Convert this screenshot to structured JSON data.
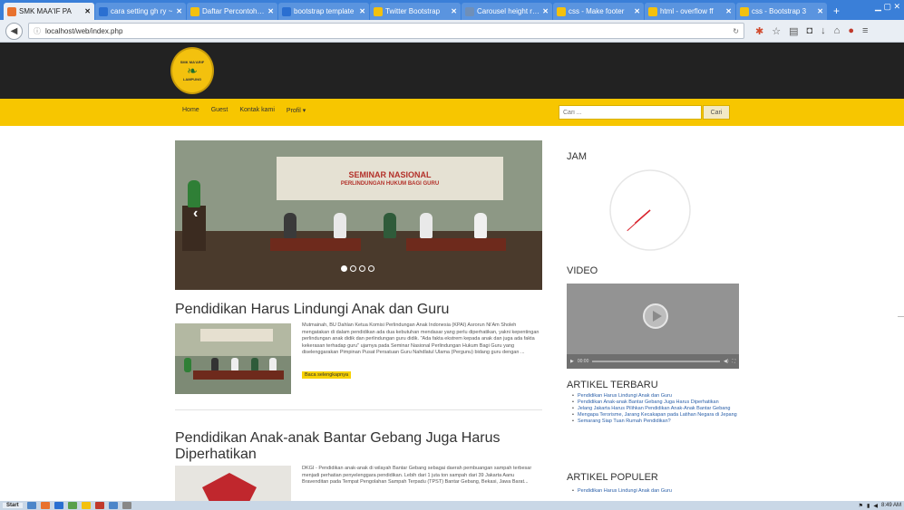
{
  "browser": {
    "tabs": [
      {
        "label": "SMK MAA'IF PA",
        "favicon_color": "#e8722e",
        "active": true
      },
      {
        "label": "cara setting gh ry ~",
        "favicon_color": "#2a6fd1",
        "active": false
      },
      {
        "label": "Daftar Percontohan",
        "favicon_color": "#f3c10e",
        "active": false
      },
      {
        "label": "bootstrap template",
        "favicon_color": "#2a6fd1",
        "active": false
      },
      {
        "label": "Twitter Bootstrap",
        "favicon_color": "#f3c10e",
        "active": false
      },
      {
        "label": "Carousel height rsp",
        "favicon_color": "#6f8fb8",
        "active": false
      },
      {
        "label": "css - Make footer",
        "favicon_color": "#f3c10e",
        "active": false
      },
      {
        "label": "html - overflow ff",
        "favicon_color": "#f3c10e",
        "active": false
      },
      {
        "label": "css - Bootstrap 3",
        "favicon_color": "#f3c10e",
        "active": false
      }
    ],
    "url": "localhost/web/index.php"
  },
  "site": {
    "logo": {
      "top_text": "SMK MA'ARIF",
      "bottom_text": "LAMPUNG"
    },
    "menu": [
      {
        "label": "Home"
      },
      {
        "label": "Guest"
      },
      {
        "label": "Kontak kami"
      },
      {
        "label": "Profil ▾"
      }
    ],
    "search": {
      "placeholder": "Cari ...",
      "button": "Cari"
    }
  },
  "slider": {
    "banner_title": "SEMINAR NASIONAL",
    "banner_subtitle": "PERLINDUNGAN HUKUM BAGI GURU",
    "prev": "‹"
  },
  "articles": [
    {
      "title": "Pendidikan Harus Lindungi Anak dan Guru",
      "excerpt": "Mutmainah, BU Dahlan Ketua Komisi Perlindungan Anak Indonesia (KPAI) Asrorun Ni'Am Sholeh mengatakan di dalam pendidikan ada dua kebutuhan mendasar yang perlu diperhatikan, yakni kepentingan perlindungan anak didik dan perlindungan guru didik. \"Ada fakta ekstrem kepada anak dan juga ada fakta kekerasan terhadap guru\" ujarnya pada Seminar Nasional Perlindungan Hukum Bagi Guru yang diselenggarakan Pimpinan Pusat Persatuan Guru Nahdlatul Ulama (Pergunu) bidang guru dengan ...",
      "read_more": "Baca selengkapnya"
    },
    {
      "title": "Pendidikan Anak-anak Bantar Gebang Juga Harus Diperhatikan",
      "excerpt": "DKGI - Pendidikan anak-anak di wilayah Bantar Gebang sebagai daerah pembuangan sampah terbesar menjadi perhatian penyelenggara pendidikan. Lebih dari 1 juta ton sampah dari 39 Jakarta Aanu Bravenditan pada Tempat Pengolahan Sampah Terpadu (TPST) Bantar Gebang, Bekasi, Jawa Barat..."
    }
  ],
  "sidebar": {
    "jam_heading": "JAM",
    "video_heading": "VIDEO",
    "terbaru_heading": "ARTIKEL TERBARU",
    "populer_heading": "ARTIKEL POPULER",
    "terbaru": [
      "Pendidikan Harus Lindungi Anak dan Guru",
      "Pendidikan Anak-anak Bantar Gebang Juga Harus Diperhatikan",
      "Jelang Jakarta Harus Pilihkan Pendidikan Anak-Anak Bantar Gebang",
      "Mengapa Terorisme, Jarang Kecakapan pada Latihan Negara di Jepang",
      "Semarang Siap Tuan Rumah Pendidikan?"
    ],
    "populer": [
      "Pendidikan Harus Lindungi Anak dan Guru"
    ],
    "video_time": "00:00",
    "clock": {
      "hour": 7,
      "minute": 38
    }
  },
  "taskbar": {
    "start": "Start",
    "time": "8:49 AM"
  },
  "colors": {
    "header_dark": "#222222",
    "accent_yellow": "#f7c600",
    "link_blue": "#2a5fa8",
    "clock_hand": "#d9232d"
  }
}
